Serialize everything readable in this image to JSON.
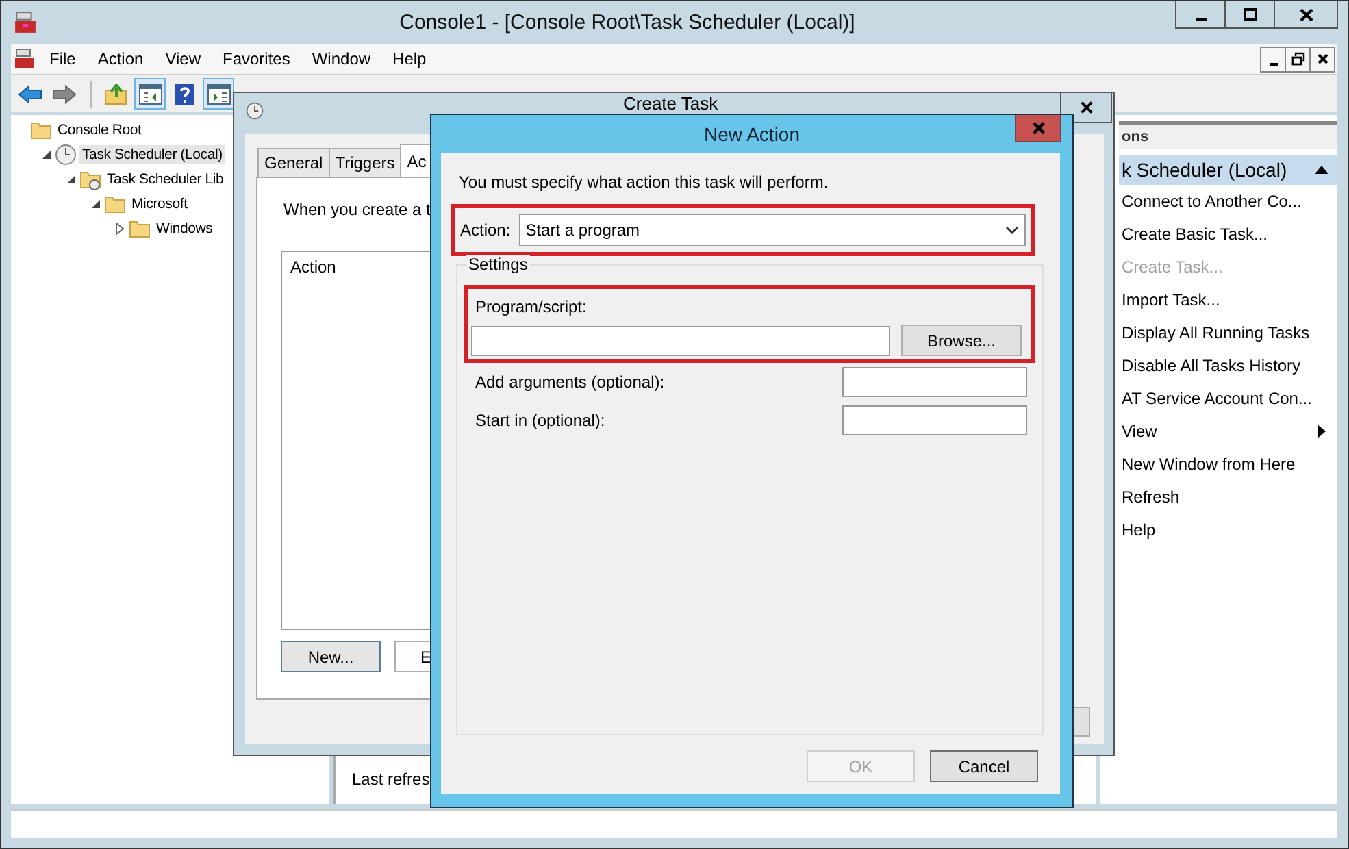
{
  "main_window": {
    "title": "Console1 - [Console Root\\Task Scheduler (Local)]",
    "menu": [
      "File",
      "Action",
      "View",
      "Favorites",
      "Window",
      "Help"
    ],
    "toolbar": [
      {
        "kind": "back",
        "pressed": false
      },
      {
        "kind": "forward",
        "pressed": false
      },
      {
        "kind": "separator"
      },
      {
        "kind": "up",
        "pressed": false
      },
      {
        "kind": "tree",
        "pressed": true
      },
      {
        "kind": "help",
        "pressed": false
      },
      {
        "kind": "pane",
        "pressed": true
      }
    ],
    "tree": [
      {
        "label": "Console Root",
        "kind": "folder",
        "selected": false,
        "children": [
          {
            "label": "Task Scheduler (Local)",
            "kind": "clock",
            "expanded": true,
            "selected": true,
            "children": [
              {
                "label": "Task Scheduler Lib",
                "kind": "library",
                "expanded": true,
                "selected": false,
                "children": [
                  {
                    "label": "Microsoft",
                    "kind": "folder",
                    "expanded": true,
                    "selected": false,
                    "children": [
                      {
                        "label": "Windows",
                        "kind": "folder",
                        "expanded": false,
                        "selected": false
                      }
                    ]
                  }
                ]
              }
            ]
          }
        ]
      }
    ],
    "status_text": "Last refres",
    "actions_pane": {
      "header": "ons",
      "section": {
        "title": "k Scheduler (Local)",
        "expanded": true
      },
      "items": [
        {
          "label": "Connect to Another Co...",
          "disabled": false,
          "submenu": false
        },
        {
          "label": "Create Basic Task...",
          "disabled": false,
          "submenu": false
        },
        {
          "label": "Create Task...",
          "disabled": true,
          "submenu": false
        },
        {
          "label": "Import Task...",
          "disabled": false,
          "submenu": false
        },
        {
          "label": "Display All Running Tasks",
          "disabled": false,
          "submenu": false
        },
        {
          "label": "Disable All Tasks History",
          "disabled": false,
          "submenu": false
        },
        {
          "label": "AT Service Account Con...",
          "disabled": false,
          "submenu": false
        },
        {
          "label": "View",
          "disabled": false,
          "submenu": true
        },
        {
          "label": "New Window from Here",
          "disabled": false,
          "submenu": false
        },
        {
          "label": "Refresh",
          "disabled": false,
          "submenu": false
        },
        {
          "label": "Help",
          "disabled": false,
          "submenu": false
        }
      ]
    }
  },
  "create_task": {
    "title": "Create Task",
    "tabs": [
      {
        "label": "General",
        "selected": false
      },
      {
        "label": "Triggers",
        "selected": false
      },
      {
        "label": "Ac",
        "selected": true
      }
    ],
    "intro": "When you create a t",
    "list": {
      "column": "Action"
    },
    "buttons": [
      "New...",
      "E"
    ]
  },
  "new_action": {
    "title": "New Action",
    "intro": "You must specify what action this task will perform.",
    "action": {
      "label": "Action:",
      "value": "Start a program",
      "highlighted": true
    },
    "settings": {
      "legend": "Settings",
      "program": {
        "label": "Program/script:",
        "highlighted": true,
        "browse": "Browse..."
      },
      "fields": [
        {
          "label": "Add arguments (optional):"
        },
        {
          "label": "Start in (optional):"
        }
      ]
    },
    "buttons": [
      {
        "label": "OK",
        "disabled": true
      },
      {
        "label": "Cancel",
        "disabled": false
      }
    ]
  }
}
